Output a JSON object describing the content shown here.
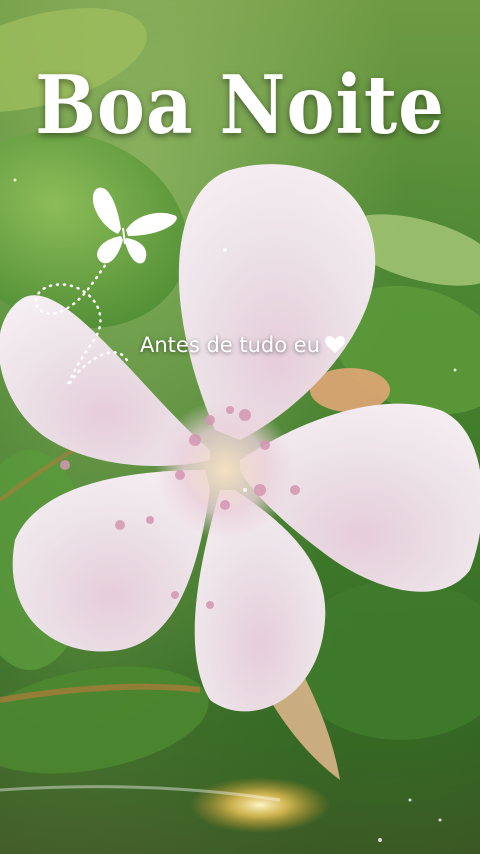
{
  "overlay": {
    "title": "Boa Noite",
    "subtitle": "Antes de tudo eu",
    "heart_icon": "heart-icon",
    "butterfly_icon": "butterfly-icon"
  },
  "colors": {
    "petal": "#e9dde4",
    "petal_edge": "#f3ecf0",
    "stamen": "#d49ab5",
    "leaf": "#4f8a34",
    "text": "#ffffff"
  }
}
